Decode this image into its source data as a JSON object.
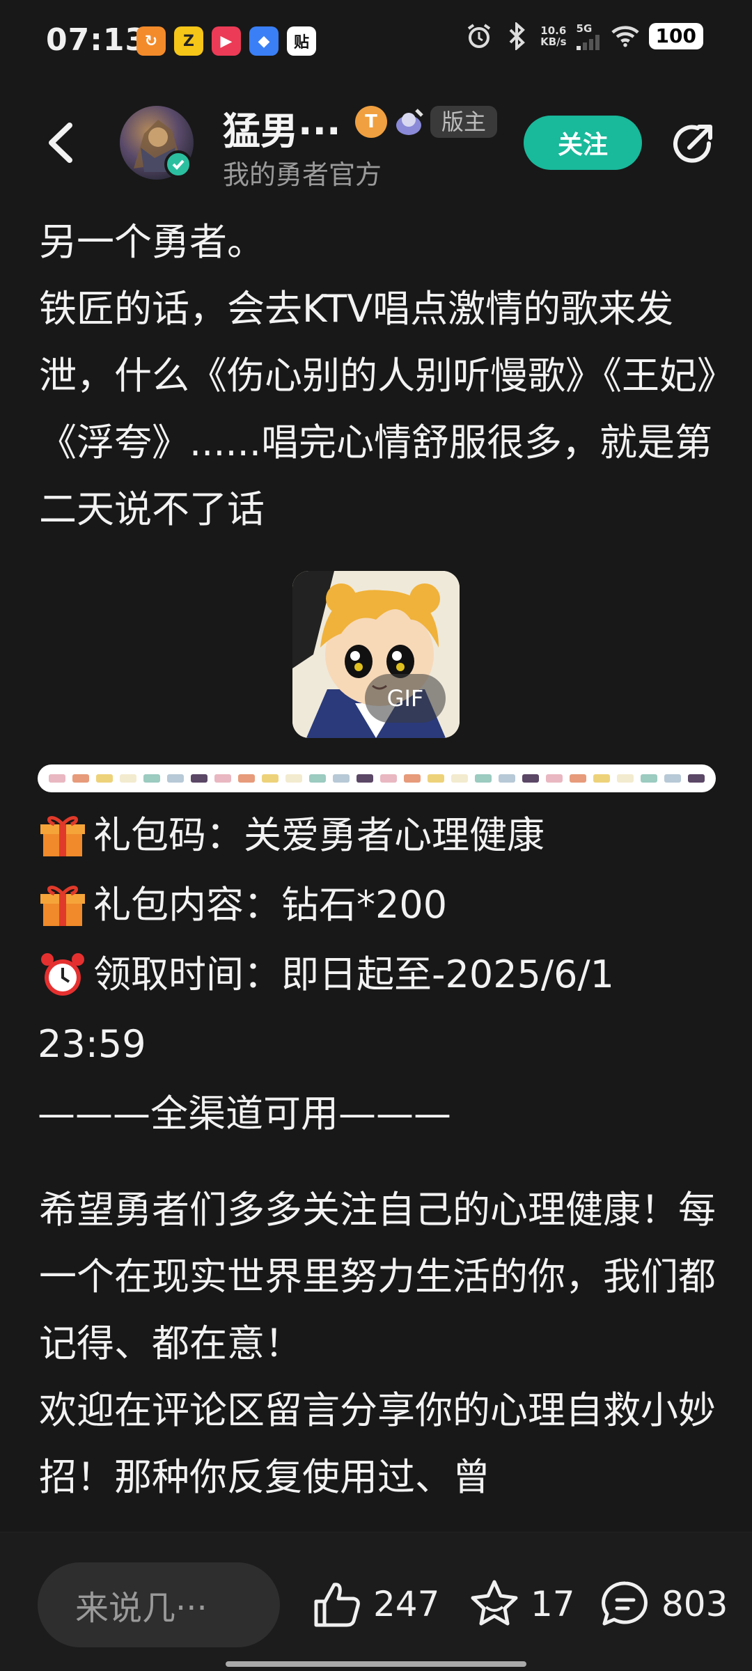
{
  "status_bar": {
    "time": "07:13",
    "app_icons": [
      {
        "name": "orange-app-icon",
        "glyph": "↻",
        "color": "#f38b2b"
      },
      {
        "name": "yellow-game-icon",
        "glyph": "Z",
        "color": "#f5c518"
      },
      {
        "name": "red-play-icon",
        "glyph": "▶",
        "color": "#ec3b56"
      },
      {
        "name": "blue-app-icon",
        "glyph": "◆",
        "color": "#3a7ff5"
      },
      {
        "name": "tieba-icon",
        "glyph": "贴",
        "color": "#ffffff"
      }
    ],
    "net_speed": "10.6",
    "net_unit": "KB/s",
    "network": "5G",
    "battery": "100"
  },
  "header": {
    "username": "猛男···",
    "level_badge": "T",
    "mod_label": "版主",
    "subtitle": "我的勇者官方",
    "follow_label": "关注"
  },
  "post": {
    "para1": "另一个勇者。\n铁匠的话，会去KTV唱点激情的歌来发泄，什么《伤心别的人别听慢歌》《王妃》《浮夸》......唱完心情舒服很多，就是第二天说不了话",
    "gif_label": "GIF",
    "gift_code": "礼包码：关爱勇者心理健康",
    "gift_content": "礼包内容：钻石*200",
    "claim_time": "领取时间：即日起至-2025/6/1",
    "claim_time_end": "23:59",
    "channel_line": "———全渠道可用———",
    "para2": "希望勇者们多多关注自己的心理健康！每一个在现实世界里努力生活的你，我们都记得、都在意！\n欢迎在评论区留言分享你的心理自救小妙招！那种你反复使用过、曾"
  },
  "bottom_bar": {
    "comment_placeholder": "来说几···",
    "likes": "247",
    "favorites": "17",
    "comments": "803"
  },
  "colors": {
    "accent": "#19b99b",
    "background": "#181818"
  }
}
